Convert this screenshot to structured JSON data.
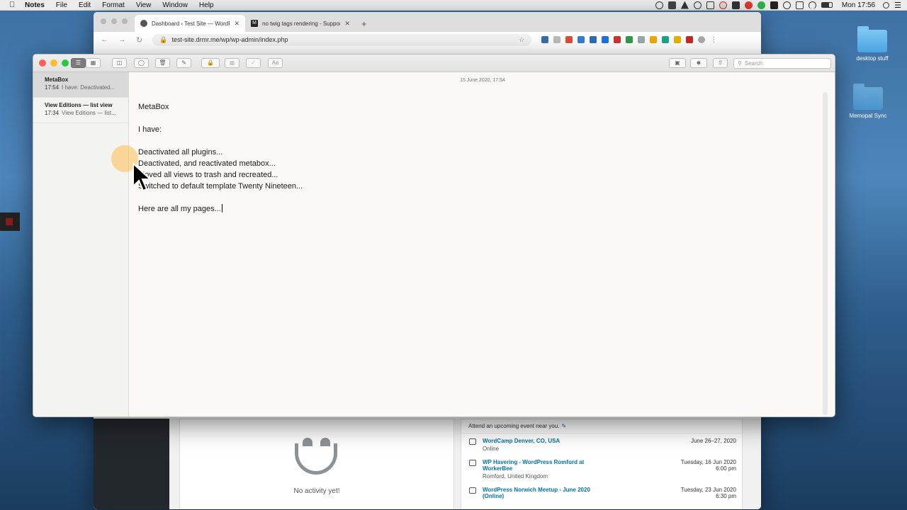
{
  "menubar": {
    "app": "Notes",
    "items": [
      "File",
      "Edit",
      "Format",
      "View",
      "Window",
      "Help"
    ],
    "clock": "Mon 17:56"
  },
  "desktop": {
    "icons": [
      {
        "label": "desktop stuff"
      },
      {
        "label": "Memopal Sync"
      }
    ]
  },
  "browser": {
    "tabs": [
      {
        "title": "Dashboard ‹ Test Site — WordPress",
        "active": true
      },
      {
        "title": "no twig tags rendering - Support",
        "active": false
      }
    ],
    "url": "test-site.drmr.me/wp/wp-admin/index.php",
    "activity": {
      "empty_text": "No activity yet!"
    },
    "events": {
      "intro": "Attend an upcoming event near you.",
      "items": [
        {
          "title": "WordCamp Denver, CO, USA",
          "location": "Online",
          "date": "June 26–27, 2020",
          "time": ""
        },
        {
          "title": "WP Havering - WordPress Romford at WorkerBee",
          "location": "Romford, United Kingdom",
          "date": "Tuesday, 16 Jun 2020",
          "time": "6:00 pm"
        },
        {
          "title": "WordPress Norwich Meetup - June 2020 (Online)",
          "location": "",
          "date": "Tuesday, 23 Jun 2020",
          "time": "6:30 pm"
        }
      ]
    }
  },
  "notes": {
    "search_placeholder": "Search",
    "list": [
      {
        "title": "MetaBox",
        "time": "17:54",
        "preview": "I have: Deactivated...",
        "selected": true
      },
      {
        "title": "View Editions — list view",
        "time": "17:34",
        "preview": "View Editions — list...",
        "selected": false
      }
    ],
    "editor": {
      "date": "15 June 2020, 17:54",
      "lines": [
        "MetaBox",
        "",
        "I have:",
        "",
        "Deactivated all plugins...",
        "Deactivated, and reactivated metabox...",
        "Moved all views to trash and recreated...",
        "Switched to default template Twenty Nineteen...",
        "",
        "Here are all my pages..."
      ]
    }
  },
  "colors": {
    "close": "#fe5f57",
    "minimize": "#febc2e",
    "zoom": "#28c840",
    "wp_link": "#0073aa",
    "cursor_highlight": "#fdbe50"
  }
}
